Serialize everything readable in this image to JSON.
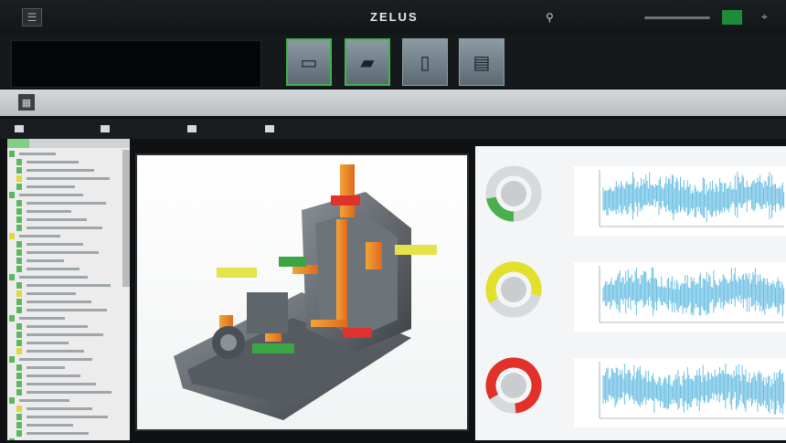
{
  "topbar": {
    "left_title": "",
    "app_title": "ZELUS",
    "status_text": "",
    "badge_text": ""
  },
  "thumbnails": [
    {
      "icon_name": "monitor-icon",
      "active": true
    },
    {
      "icon_name": "box-icon",
      "active": true
    },
    {
      "icon_name": "door-icon",
      "active": false
    },
    {
      "icon_name": "document-icon",
      "active": false
    }
  ],
  "view": {
    "title": ""
  },
  "toolbar": {
    "items": [
      {
        "label": ""
      },
      {
        "label": ""
      },
      {
        "label": ""
      },
      {
        "label": ""
      }
    ]
  },
  "sidebar": {
    "tabs": [
      "",
      "",
      ""
    ],
    "tree_count": 36
  },
  "model_labels": [
    {
      "text": "",
      "color": "red"
    },
    {
      "text": "",
      "color": "green"
    },
    {
      "text": "",
      "color": "yellow"
    },
    {
      "text": "",
      "color": "yellow"
    },
    {
      "text": "",
      "color": "red"
    },
    {
      "text": "",
      "color": "green"
    }
  ],
  "right_panel": {
    "sections": [
      {
        "title": "",
        "gauge_color": "#49b04d",
        "gauge_value": 0.22
      },
      {
        "title": "",
        "gauge_color": "#e2e02a",
        "gauge_value": 0.62
      },
      {
        "title": "",
        "gauge_color": "#e2312b",
        "gauge_value": 0.82
      }
    ]
  },
  "colors": {
    "accent_green": "#3fb44b",
    "alert_red": "#e0312d",
    "warning_yellow": "#e6e24a",
    "chart_blue": "#3aa9d9"
  }
}
